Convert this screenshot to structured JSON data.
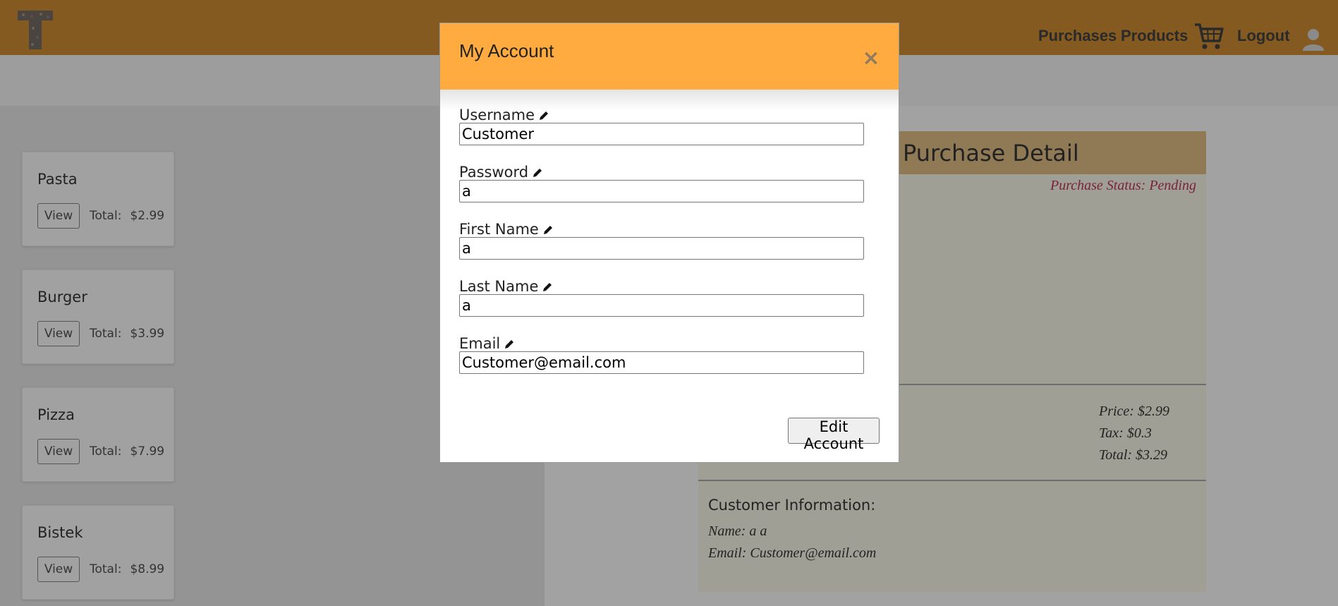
{
  "navbar": {
    "links": [
      "Purchases",
      "Products",
      "Logout"
    ],
    "cart_icon": "shopping-cart-icon",
    "avatar_icon": "user-avatar-icon",
    "bg_color": "#855a20"
  },
  "products": [
    {
      "name": "Pasta",
      "view_label": "View",
      "total_label": "Total:",
      "total_value": "$2.99"
    },
    {
      "name": "Burger",
      "view_label": "View",
      "total_label": "Total:",
      "total_value": "$3.99"
    },
    {
      "name": "Pizza",
      "view_label": "View",
      "total_label": "Total:",
      "total_value": "$7.99"
    },
    {
      "name": "Bistek",
      "view_label": "View",
      "total_label": "Total:",
      "total_value": "$8.99"
    }
  ],
  "detail": {
    "title": "Purchase Detail",
    "status": "Purchase Status: Pending",
    "price": "Price: $2.99",
    "tax": "Tax: $0.3",
    "total": "Total: $3.29",
    "customer_label": "Customer Information:",
    "customer_name": "Name: a a",
    "customer_email": "Email: Customer@email.com"
  },
  "modal": {
    "title": "My Account",
    "close_symbol": "×",
    "fields": [
      {
        "label": "Username",
        "value": "Customer"
      },
      {
        "label": "Password",
        "value": "a"
      },
      {
        "label": "First Name",
        "value": "a"
      },
      {
        "label": "Last Name",
        "value": "a"
      },
      {
        "label": "Email",
        "value": "Customer@email.com"
      }
    ],
    "submit_label": "Edit Account",
    "header_color": "#ffab40"
  }
}
